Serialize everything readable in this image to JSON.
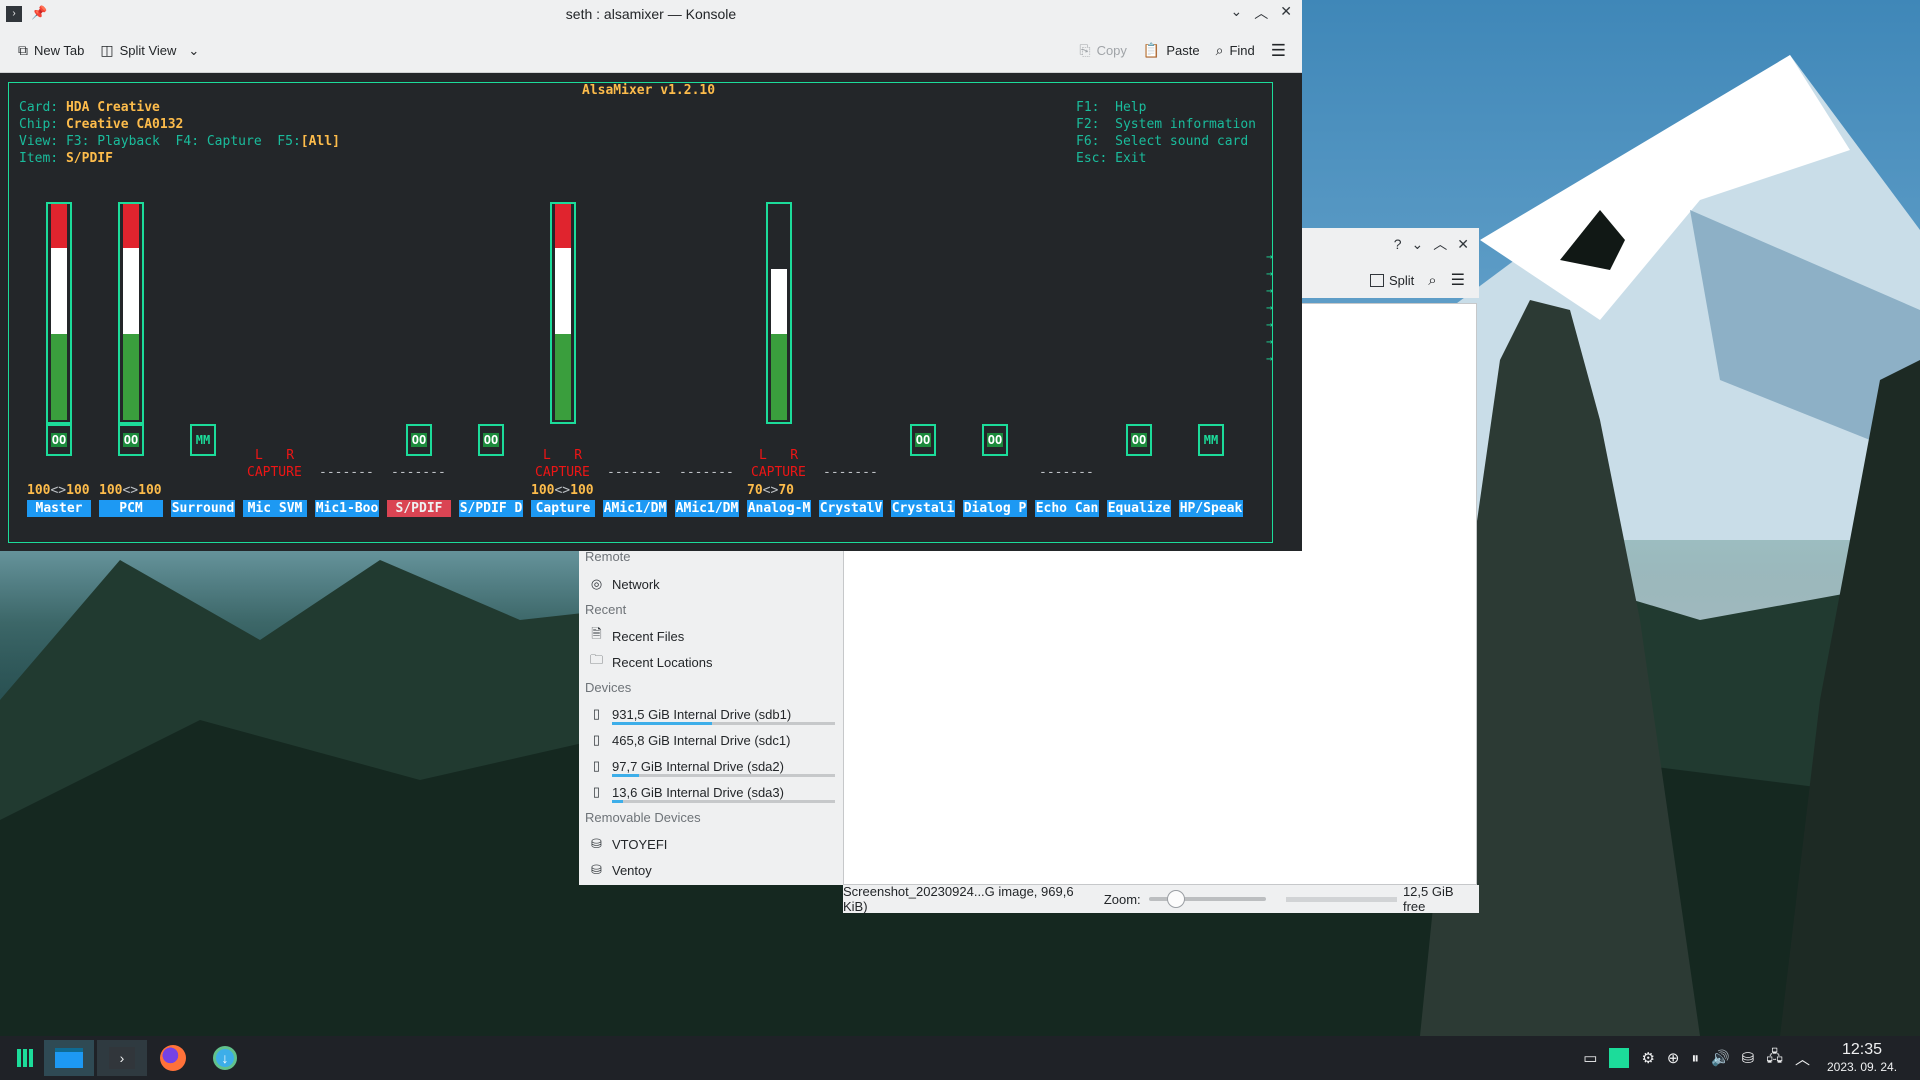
{
  "konsole": {
    "title": "seth : alsamixer — Konsole",
    "toolbar": {
      "new_tab": "New Tab",
      "split_view": "Split View",
      "copy": "Copy",
      "paste": "Paste",
      "find": "Find"
    }
  },
  "alsamixer": {
    "title": "AlsaMixer v1.2.10",
    "card_label": "Card:",
    "card_value": "HDA Creative",
    "chip_label": "Chip:",
    "chip_value": "Creative CA0132",
    "view_label": "View:",
    "view_f3": "F3: Playback",
    "view_f4": "F4: Capture",
    "view_f5_key": "F5:",
    "view_f5_value": "[All]",
    "item_label": "Item:",
    "item_value": "S/PDIF",
    "help": [
      "F1:  Help",
      "F2:  System information",
      "F6:  Select sound card",
      "Esc: Exit"
    ],
    "channels": [
      {
        "label": "Master",
        "mute": "OO",
        "meter_level": 1.0,
        "volume": [
          "100",
          "100"
        ]
      },
      {
        "label": "PCM",
        "mute": "OO",
        "meter_level": 1.0,
        "volume": [
          "100",
          "100"
        ]
      },
      {
        "label": "Surround",
        "mute": "MM"
      },
      {
        "label": "Mic SVM",
        "capture": true
      },
      {
        "label": "Mic1-Boo",
        "dashes": "-------"
      },
      {
        "label": "S/PDIF",
        "mute": "OO",
        "dashes": "-------",
        "selected": true
      },
      {
        "label": "S/PDIF D",
        "mute": "OO"
      },
      {
        "label": "Capture",
        "capture": true,
        "meter_level": 1.0,
        "volume": [
          "100",
          "100"
        ]
      },
      {
        "label": "AMic1/DM",
        "dashes": "-------"
      },
      {
        "label": "AMic1/DM",
        "dashes": "-------"
      },
      {
        "label": "Analog-M",
        "capture": true,
        "meter_level": 0.7,
        "volume": [
          "70",
          "70"
        ]
      },
      {
        "label": "CrystalV",
        "dashes": "-------"
      },
      {
        "label": "Crystali",
        "mute": "OO"
      },
      {
        "label": "Dialog P",
        "mute": "OO"
      },
      {
        "label": "Echo Can",
        "dashes": "-------"
      },
      {
        "label": "Equalize",
        "mute": "OO"
      },
      {
        "label": "HP/Speak",
        "mute": "MM"
      }
    ],
    "capture_lr": "L   R",
    "capture_word": "CAPTURE",
    "vol_sep": "<>"
  },
  "dolphin": {
    "toolbar": {
      "split": "Split"
    },
    "places": {
      "remote_group": "Remote",
      "network": "Network",
      "recent_group": "Recent",
      "recent_files": "Recent Files",
      "recent_locations": "Recent Locations",
      "devices_group": "Devices",
      "drives": [
        {
          "label": "931,5 GiB Internal Drive (sdb1)",
          "used": 0.45
        },
        {
          "label": "465,8 GiB Internal Drive (sdc1)",
          "used": 0
        },
        {
          "label": "97,7 GiB Internal Drive (sda2)",
          "used": 0.12
        },
        {
          "label": "13,6 GiB Internal Drive (sda3)",
          "used": 0.05
        }
      ],
      "removable_group": "Removable Devices",
      "removable": [
        "VTOYEFI",
        "Ventoy"
      ]
    },
    "status": {
      "file_info": "Screenshot_20230924...G image, 969,6 KiB)",
      "zoom_label": "Zoom:",
      "free": "12,5 GiB free"
    }
  },
  "taskbar": {
    "time": "12:35",
    "date": "2023. 09. 24."
  },
  "colors": {
    "terminal_bg": "#232629",
    "alsa_teal": "#1cdc9a",
    "alsa_yellow": "#fdbc4b",
    "alsa_label_blue": "#1d99f3",
    "alsa_selected": "#da4453",
    "breeze_light": "#eff0f1"
  }
}
